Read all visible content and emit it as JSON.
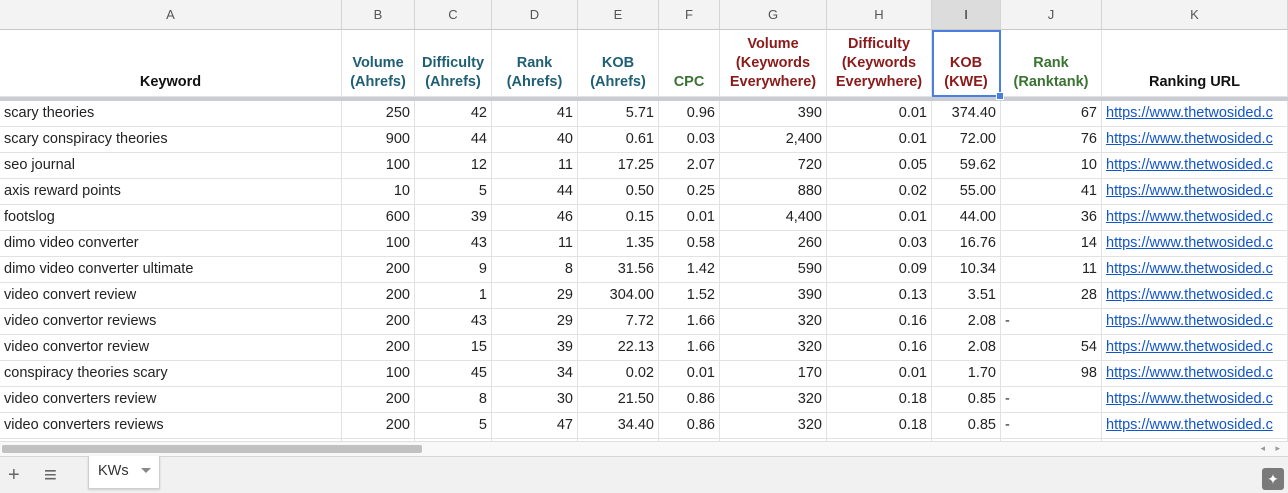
{
  "columns": [
    "A",
    "B",
    "C",
    "D",
    "E",
    "F",
    "G",
    "H",
    "I",
    "J",
    "K"
  ],
  "selected_column": "I",
  "headers": [
    {
      "lines": [
        "Keyword"
      ],
      "color": "black"
    },
    {
      "lines": [
        "Volume",
        "(Ahrefs)"
      ],
      "color": "teal"
    },
    {
      "lines": [
        "Difficulty",
        "(Ahrefs)"
      ],
      "color": "teal"
    },
    {
      "lines": [
        "Rank",
        "(Ahrefs)"
      ],
      "color": "teal"
    },
    {
      "lines": [
        "KOB",
        "(Ahrefs)"
      ],
      "color": "teal"
    },
    {
      "lines": [
        "CPC"
      ],
      "color": "green"
    },
    {
      "lines": [
        "Volume",
        "(Keywords",
        "Everywhere)"
      ],
      "color": "red"
    },
    {
      "lines": [
        "Difficulty",
        "(Keywords",
        "Everywhere)"
      ],
      "color": "red"
    },
    {
      "lines": [
        "KOB",
        "(KWE)"
      ],
      "color": "red"
    },
    {
      "lines": [
        "Rank",
        "(Ranktank)"
      ],
      "color": "green"
    },
    {
      "lines": [
        "Ranking URL"
      ],
      "color": "black"
    }
  ],
  "rows": [
    [
      "scary theories",
      "250",
      "42",
      "41",
      "5.71",
      "0.96",
      "390",
      "0.01",
      "374.40",
      "67",
      "https://www.thetwosided.c"
    ],
    [
      "scary conspiracy theories",
      "900",
      "44",
      "40",
      "0.61",
      "0.03",
      "2,400",
      "0.01",
      "72.00",
      "76",
      "https://www.thetwosided.c"
    ],
    [
      "seo journal",
      "100",
      "12",
      "11",
      "17.25",
      "2.07",
      "720",
      "0.05",
      "59.62",
      "10",
      "https://www.thetwosided.c"
    ],
    [
      "axis reward points",
      "10",
      "5",
      "44",
      "0.50",
      "0.25",
      "880",
      "0.02",
      "55.00",
      "41",
      "https://www.thetwosided.c"
    ],
    [
      "footslog",
      "600",
      "39",
      "46",
      "0.15",
      "0.01",
      "4,400",
      "0.01",
      "44.00",
      "36",
      "https://www.thetwosided.c"
    ],
    [
      "dimo video converter",
      "100",
      "43",
      "11",
      "1.35",
      "0.58",
      "260",
      "0.03",
      "16.76",
      "14",
      "https://www.thetwosided.c"
    ],
    [
      "dimo video converter ultimate",
      "200",
      "9",
      "8",
      "31.56",
      "1.42",
      "590",
      "0.09",
      "10.34",
      "11",
      "https://www.thetwosided.c"
    ],
    [
      "video convert review",
      "200",
      "1",
      "29",
      "304.00",
      "1.52",
      "390",
      "0.13",
      "3.51",
      "28",
      "https://www.thetwosided.c"
    ],
    [
      "video convertor reviews",
      "200",
      "43",
      "29",
      "7.72",
      "1.66",
      "320",
      "0.16",
      "2.08",
      "-",
      "https://www.thetwosided.c"
    ],
    [
      "video convertor review",
      "200",
      "15",
      "39",
      "22.13",
      "1.66",
      "320",
      "0.16",
      "2.08",
      "54",
      "https://www.thetwosided.c"
    ],
    [
      "conspiracy theories scary",
      "100",
      "45",
      "34",
      "0.02",
      "0.01",
      "170",
      "0.01",
      "1.70",
      "98",
      "https://www.thetwosided.c"
    ],
    [
      "video converters review",
      "200",
      "8",
      "30",
      "21.50",
      "0.86",
      "320",
      "0.18",
      "0.85",
      "-",
      "https://www.thetwosided.c"
    ],
    [
      "video converters reviews",
      "200",
      "5",
      "47",
      "34.40",
      "0.86",
      "320",
      "0.18",
      "0.85",
      "-",
      "https://www.thetwosided.c"
    ]
  ],
  "colors": {
    "teal": "#1f5f73",
    "red": "#8b1a1a",
    "green": "#3a7232",
    "link": "#1155cc",
    "selection": "#4a7ee0"
  },
  "tabbar": {
    "add_icon": "plus-icon",
    "add_symbol": "+",
    "list_icon": "hamburger-list-icon",
    "list_symbol": "≡",
    "tab_label": "KWs",
    "explore_icon": "explore-icon",
    "explore_symbol": "✦"
  }
}
